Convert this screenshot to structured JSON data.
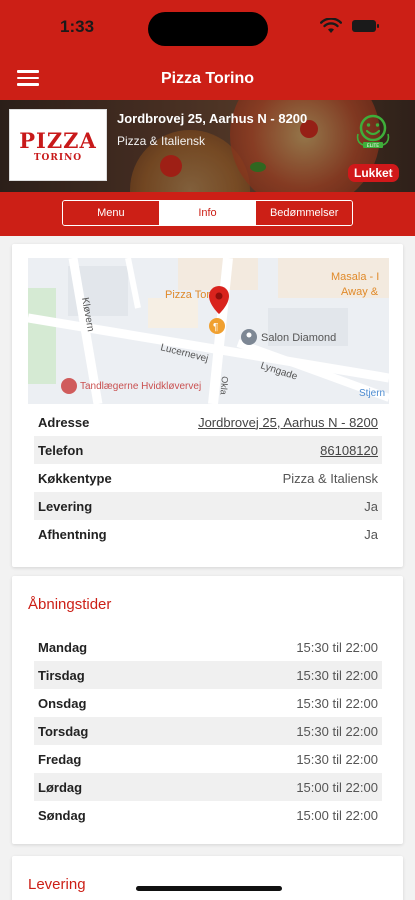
{
  "status_bar": {
    "time": "1:33"
  },
  "header": {
    "title": "Pizza Torino"
  },
  "restaurant": {
    "logo_text": "PIZZA",
    "logo_subtext": "TORINO",
    "address": "Jordbrovej 25, Aarhus N - 8200",
    "category": "Pizza & Italiensk",
    "status": "Lukket",
    "smiley_label": "ELITE"
  },
  "tabs": [
    {
      "label": "Menu",
      "active": false
    },
    {
      "label": "Info",
      "active": true
    },
    {
      "label": "Bedømmelser",
      "active": false
    }
  ],
  "map": {
    "streets": [
      "Kløvern",
      "Lucernevej",
      "Lyngade",
      "Okla"
    ],
    "places": [
      "Pizza Torino",
      "Salon Diamond",
      "Tandlægerne Hvidkløvervej",
      "Masala - I",
      "Away &",
      "Stjern"
    ]
  },
  "info": {
    "rows": [
      {
        "label": "Adresse",
        "value": "Jordbrovej 25, Aarhus N - 8200"
      },
      {
        "label": "Telefon",
        "value": "86108120"
      },
      {
        "label": "Køkkentype",
        "value": "Pizza & Italiensk"
      },
      {
        "label": "Levering",
        "value": "Ja"
      },
      {
        "label": "Afhentning",
        "value": "Ja"
      }
    ]
  },
  "hours": {
    "title": "Åbningstider",
    "rows": [
      {
        "day": "Mandag",
        "time": "15:30 til 22:00"
      },
      {
        "day": "Tirsdag",
        "time": "15:30 til 22:00"
      },
      {
        "day": "Onsdag",
        "time": "15:30 til 22:00"
      },
      {
        "day": "Torsdag",
        "time": "15:30 til 22:00"
      },
      {
        "day": "Fredag",
        "time": "15:30 til 22:00"
      },
      {
        "day": "Lørdag",
        "time": "15:00 til 22:00"
      },
      {
        "day": "Søndag",
        "time": "15:00 til 22:00"
      }
    ]
  },
  "delivery": {
    "title": "Levering"
  },
  "colors": {
    "brand_red": "#cc1f16",
    "smiley_green": "#3fae3a"
  }
}
